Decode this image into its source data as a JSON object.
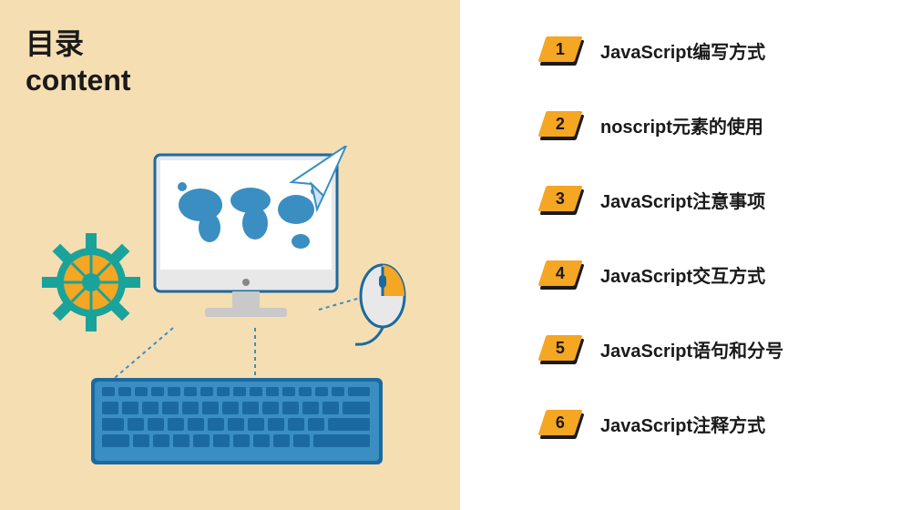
{
  "title_cn": "目录",
  "title_en": "content",
  "toc": [
    {
      "num": "1",
      "label": "JavaScript编写方式"
    },
    {
      "num": "2",
      "label": "noscript元素的使用"
    },
    {
      "num": "3",
      "label": "JavaScript注意事项"
    },
    {
      "num": "4",
      "label": "JavaScript交互方式"
    },
    {
      "num": "5",
      "label": "JavaScript语句和分号"
    },
    {
      "num": "6",
      "label": "JavaScript注释方式"
    }
  ],
  "colors": {
    "left_bg": "#f6deb3",
    "accent": "#f5a623",
    "teal": "#1aa39a",
    "blue": "#3a8ec2"
  }
}
